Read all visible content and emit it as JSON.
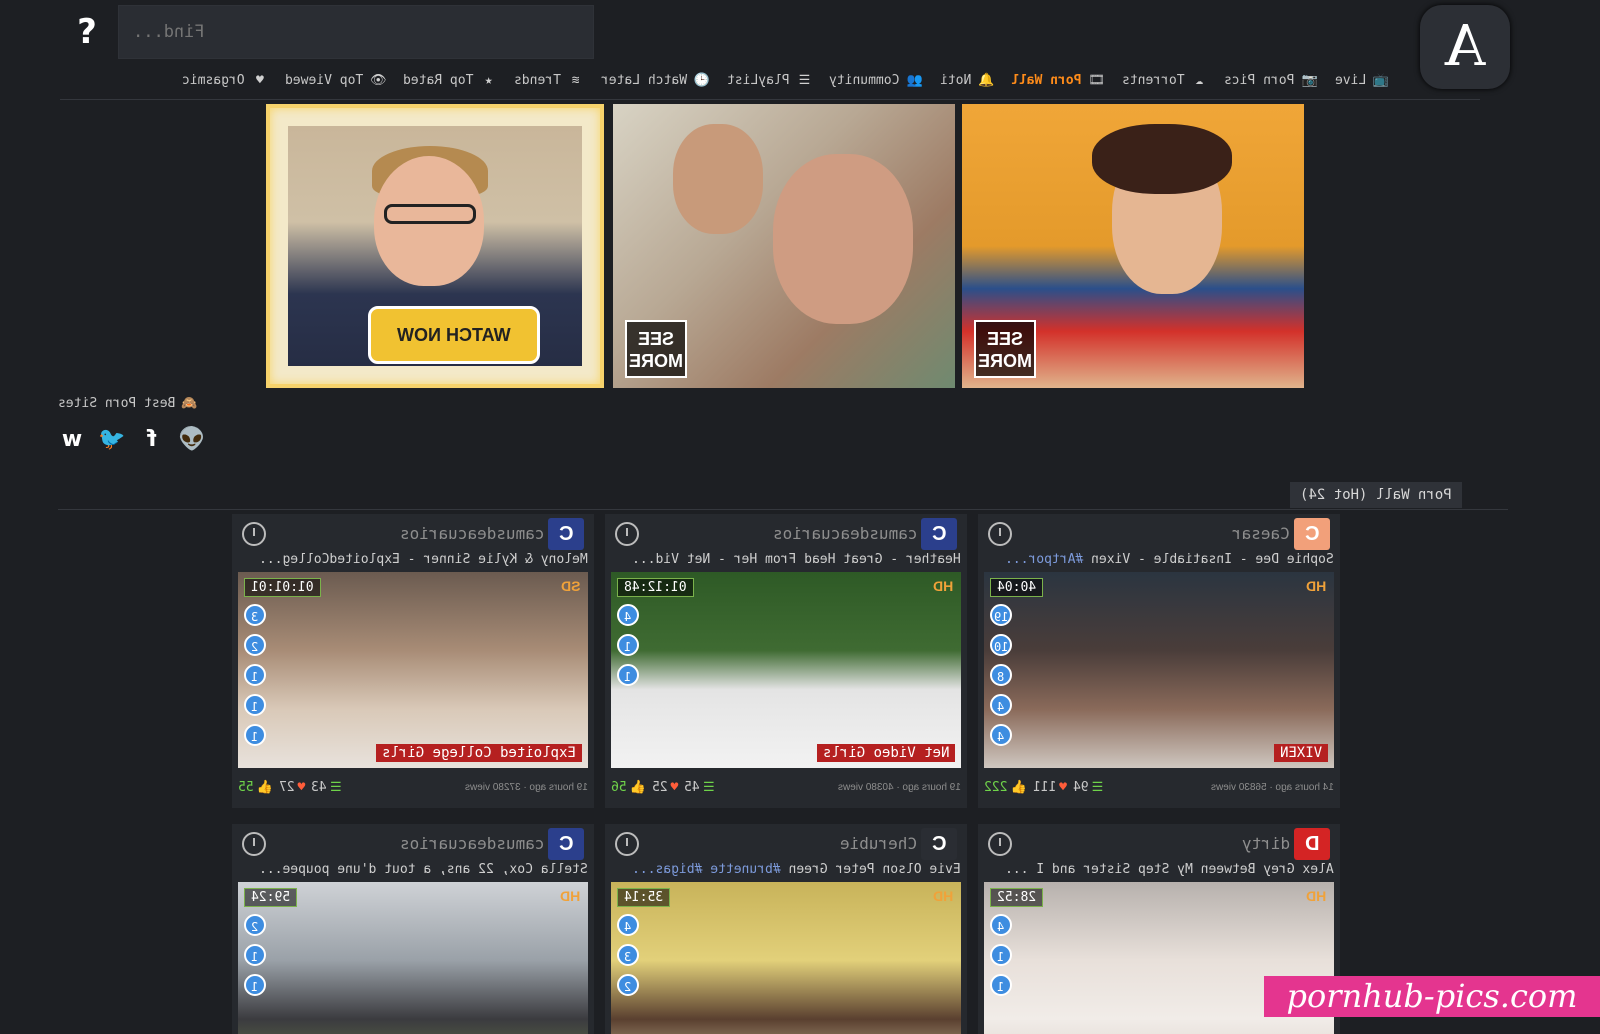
{
  "header": {
    "help_icon": "question-mark-icon",
    "search_placeholder": "Find...",
    "logo_letter": "A"
  },
  "nav": [
    {
      "label": "Live",
      "icon": "tv-icon"
    },
    {
      "label": "Porn Pics",
      "icon": "camera-icon"
    },
    {
      "label": "Torrents",
      "icon": "cloud-download-icon"
    },
    {
      "label": "Porn Wall",
      "icon": "film-reel-icon",
      "active": true
    },
    {
      "label": "Noti",
      "icon": "bell-icon"
    },
    {
      "label": "Community",
      "icon": "users-icon"
    },
    {
      "label": "PlayList",
      "icon": "list-icon"
    },
    {
      "label": "Watch Later",
      "icon": "clock-icon"
    },
    {
      "label": "Trends",
      "icon": "trend-icon"
    },
    {
      "label": "Top Rated",
      "icon": "star-icon"
    },
    {
      "label": "Top Viewed",
      "icon": "eye-icon"
    },
    {
      "label": "Orgasmic",
      "icon": "heart-icon"
    }
  ],
  "banners": {
    "watch_now": "WATCH NOW",
    "see_more": "SEE MORE"
  },
  "best_sites": {
    "label": "Best Porn Sites",
    "icon": "flame-emoji-icon"
  },
  "social": [
    "reddit-icon",
    "facebook-icon",
    "twitter-icon",
    "vk-icon"
  ],
  "section": {
    "label": "Porn Wall (Hot 24)"
  },
  "colors": {
    "accent": "#ff8c1a",
    "like": "#6fd34a",
    "heart": "#ff5d3a",
    "studio_badge": "#b52020",
    "watermark": "#e4358f"
  },
  "cards": [
    {
      "uploader": "Caesar",
      "avatar_letter": "C",
      "avatar_color": "#f2a07a",
      "title_pre": "Sophie Dee - Insatiable - Vixen ",
      "title_hash": "#Artpor...",
      "duration": "40:04",
      "quality": "HD",
      "studio": "VIXEN",
      "badges": [
        "19",
        "10",
        "8",
        "4",
        "4"
      ],
      "meta": "14 hours ago · 56830 views",
      "playlist": "94",
      "hearts": "111",
      "likes": "222"
    },
    {
      "uploader": "camusdeacuarios",
      "avatar_letter": "C",
      "avatar_color": "#2b3f8c",
      "title_pre": "Heather - Great Head From Her - Net Vid...",
      "title_hash": "",
      "duration": "01:12:48",
      "quality": "HD",
      "studio": "Net Video Girls",
      "badges": [
        "4",
        "1",
        "1"
      ],
      "meta": "19 hours ago · 40380 views",
      "playlist": "45",
      "hearts": "25",
      "likes": "56"
    },
    {
      "uploader": "camusdeacuarios",
      "avatar_letter": "C",
      "avatar_color": "#2b3f8c",
      "title_pre": "Melony & Kylie Sinner - ExploitedColleg...",
      "title_tag": "Melony & Kylie Sinner",
      "title_hash": "",
      "duration": "01:01:01",
      "quality": "SD",
      "studio": "Exploited College Girls",
      "badges": [
        "3",
        "2",
        "1",
        "1",
        "1"
      ],
      "meta": "19 hours ago · 37280 views",
      "playlist": "43",
      "hearts": "27",
      "likes": "55"
    },
    {
      "uploader": "dirty",
      "avatar_letter": "D",
      "avatar_color": "#d42424",
      "title_pre": "Alex Grey Between My Step Sister and I ...",
      "title_hash": "",
      "duration": "28:52",
      "quality": "HD",
      "studio": "",
      "badges": [
        "4",
        "1",
        "1"
      ],
      "meta": "",
      "playlist": "",
      "hearts": "",
      "likes": ""
    },
    {
      "uploader": "Cherubie",
      "avatar_letter": "C",
      "avatar_color": "#2a2d33",
      "title_pre": "Evie Olson Peter Green ",
      "title_hash": "#brunette #bigas...",
      "duration": "35:14",
      "quality": "HD",
      "studio": "",
      "badges": [
        "4",
        "3",
        "2"
      ],
      "meta": "",
      "playlist": "",
      "hearts": "",
      "likes": ""
    },
    {
      "uploader": "camusdeacuarios",
      "avatar_letter": "C",
      "avatar_color": "#2b3f8c",
      "title_pre": "Stella Cox, 22 ans, a tout d'une poupee...",
      "title_hash": "",
      "duration": "59:24",
      "quality": "HD",
      "studio": "",
      "badges": [
        "2",
        "1",
        "1"
      ],
      "meta": "",
      "playlist": "",
      "hearts": "",
      "likes": ""
    }
  ],
  "watermark": "pornhub-pics.com"
}
